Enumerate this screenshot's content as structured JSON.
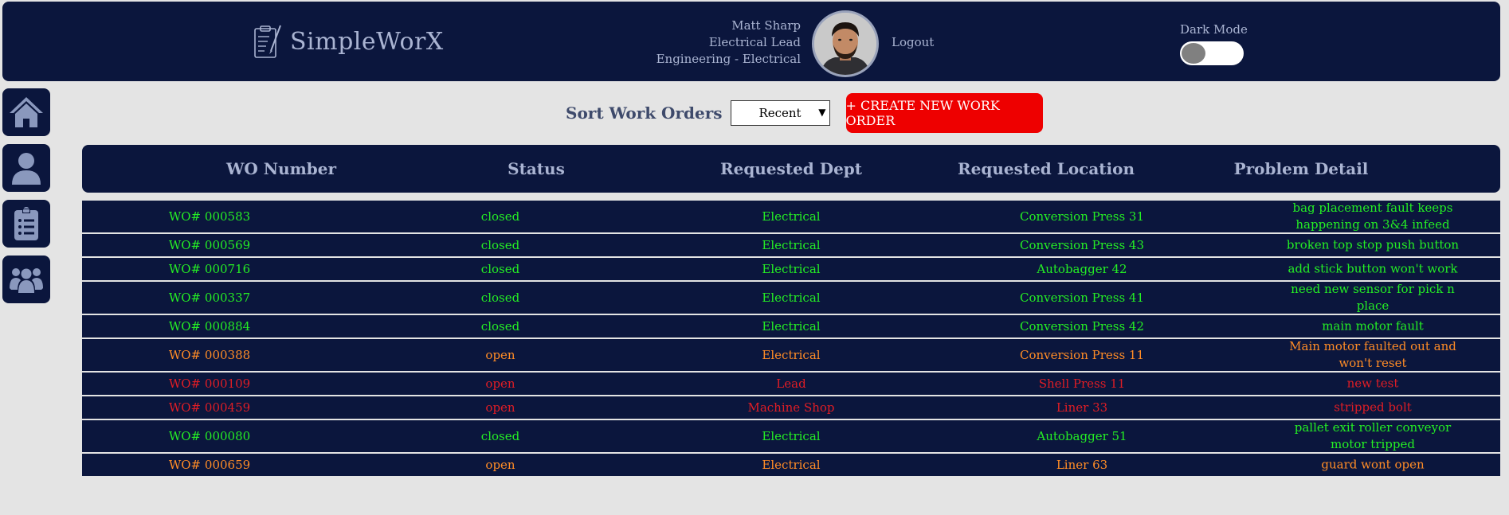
{
  "header": {
    "app_name": "SimpleWorX",
    "user": {
      "name": "Matt Sharp",
      "title": "Electrical Lead",
      "department": "Engineering - Electrical"
    },
    "logout_label": "Logout",
    "dark_mode_label": "Dark Mode",
    "dark_mode_on": false
  },
  "sidebar": {
    "items": [
      {
        "icon": "home-icon"
      },
      {
        "icon": "user-icon"
      },
      {
        "icon": "clipboard-icon"
      },
      {
        "icon": "team-icon"
      }
    ]
  },
  "toolbar": {
    "sort_label": "Sort Work Orders",
    "sort_value": "Recent",
    "create_label": "+ CREATE NEW WORK ORDER"
  },
  "table": {
    "headers": [
      "WO Number",
      "Status",
      "Requested Dept",
      "Requested Location",
      "Problem Detail"
    ],
    "rows": [
      {
        "wo": "WO# 000583",
        "status": "closed",
        "dept": "Electrical",
        "location": "Conversion Press 31",
        "detail": "bag placement fault keeps happening on 3&4 infeed",
        "color": "closed"
      },
      {
        "wo": "WO# 000569",
        "status": "closed",
        "dept": "Electrical",
        "location": "Conversion Press 43",
        "detail": "broken top stop push button",
        "color": "closed"
      },
      {
        "wo": "WO# 000716",
        "status": "closed",
        "dept": "Electrical",
        "location": "Autobagger 42",
        "detail": "add stick button won't work",
        "color": "closed"
      },
      {
        "wo": "WO# 000337",
        "status": "closed",
        "dept": "Electrical",
        "location": "Conversion Press 41",
        "detail": "need new sensor for pick n place",
        "color": "closed"
      },
      {
        "wo": "WO# 000884",
        "status": "closed",
        "dept": "Electrical",
        "location": "Conversion Press 42",
        "detail": "main motor fault",
        "color": "closed"
      },
      {
        "wo": "WO# 000388",
        "status": "open",
        "dept": "Electrical",
        "location": "Conversion Press 11",
        "detail": "Main motor faulted out and won't reset",
        "color": "open"
      },
      {
        "wo": "WO# 000109",
        "status": "open",
        "dept": "Lead",
        "location": "Shell Press 11",
        "detail": "new test",
        "color": "urgent"
      },
      {
        "wo": "WO# 000459",
        "status": "open",
        "dept": "Machine Shop",
        "location": "Liner 33",
        "detail": "stripped bolt",
        "color": "urgent"
      },
      {
        "wo": "WO# 000080",
        "status": "closed",
        "dept": "Electrical",
        "location": "Autobagger 51",
        "detail": "pallet exit roller conveyor motor tripped",
        "color": "closed"
      },
      {
        "wo": "WO# 000659",
        "status": "open",
        "dept": "Electrical",
        "location": "Liner 63",
        "detail": "guard wont open",
        "color": "open"
      }
    ]
  },
  "colors": {
    "navy": "#0b163d",
    "closed": "#24ee24",
    "open": "#ff8c26",
    "urgent": "#e01d25",
    "create_button": "#ee0000"
  }
}
